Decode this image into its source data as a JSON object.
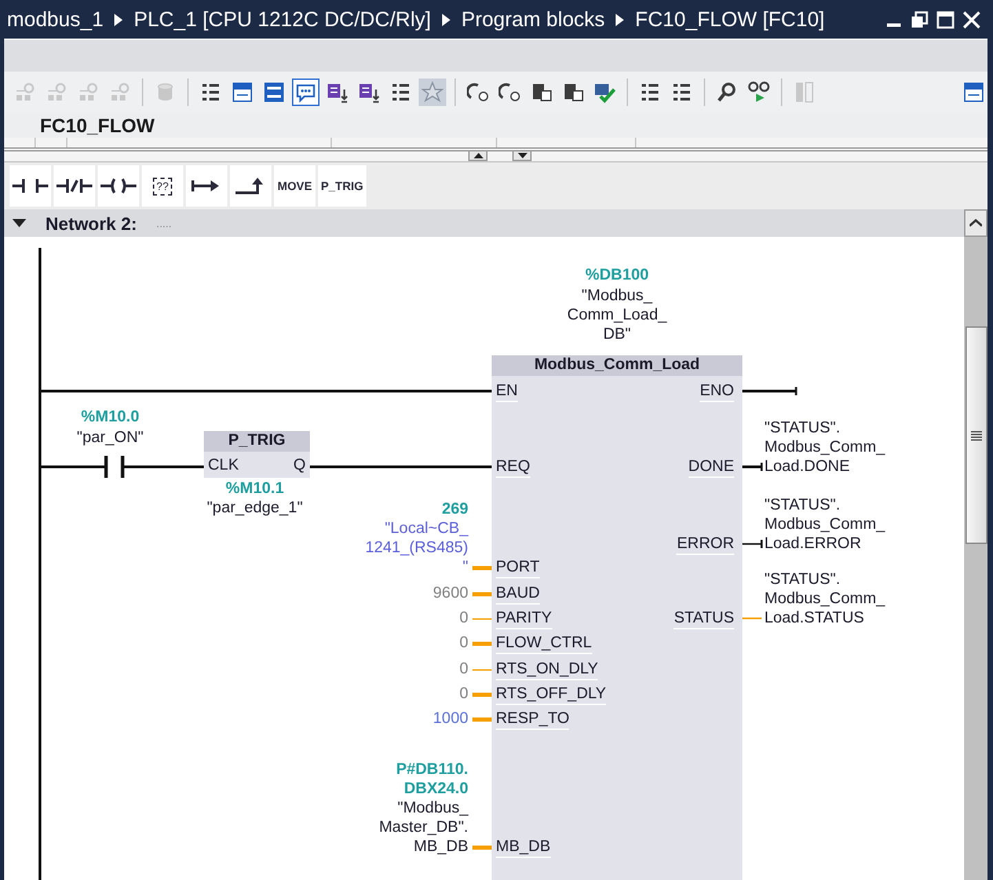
{
  "title_bar": {
    "breadcrumb": [
      "modbus_1",
      "PLC_1 [CPU 1212C DC/DC/Rly]",
      "Program blocks",
      "FC10_FLOW [FC10]"
    ]
  },
  "toolbar": [
    {
      "kind": "tool",
      "disabled": true,
      "selected": false,
      "on": false
    },
    {
      "kind": "tool",
      "disabled": true,
      "selected": false,
      "on": false
    },
    {
      "kind": "tool",
      "disabled": true,
      "selected": false,
      "on": false
    },
    {
      "kind": "tool",
      "disabled": true,
      "selected": false,
      "on": false
    },
    {
      "kind": "separator"
    },
    {
      "kind": "tool",
      "disabled": true,
      "selected": false,
      "on": false
    },
    {
      "kind": "separator"
    },
    {
      "kind": "tool",
      "disabled": false,
      "selected": false,
      "on": false
    },
    {
      "kind": "tool",
      "disabled": false,
      "selected": false,
      "on": false
    },
    {
      "kind": "tool",
      "disabled": false,
      "selected": false,
      "on": false
    },
    {
      "kind": "tool",
      "disabled": false,
      "selected": true,
      "on": false
    },
    {
      "kind": "tool",
      "disabled": false,
      "selected": false,
      "on": false
    },
    {
      "kind": "tool",
      "disabled": false,
      "selected": false,
      "on": false
    },
    {
      "kind": "tool",
      "disabled": false,
      "selected": false,
      "on": false
    },
    {
      "kind": "tool",
      "disabled": false,
      "selected": false,
      "on": true
    },
    {
      "kind": "separator"
    },
    {
      "kind": "tool",
      "disabled": false,
      "selected": false,
      "on": false
    },
    {
      "kind": "tool",
      "disabled": false,
      "selected": false,
      "on": false
    },
    {
      "kind": "tool",
      "disabled": false,
      "selected": false,
      "on": false
    },
    {
      "kind": "tool",
      "disabled": false,
      "selected": false,
      "on": false
    },
    {
      "kind": "tool",
      "disabled": false,
      "selected": false,
      "on": false
    },
    {
      "kind": "separator"
    },
    {
      "kind": "tool",
      "disabled": false,
      "selected": false,
      "on": false
    },
    {
      "kind": "tool",
      "disabled": false,
      "selected": false,
      "on": false
    },
    {
      "kind": "separator"
    },
    {
      "kind": "tool",
      "disabled": false,
      "selected": false,
      "on": false
    },
    {
      "kind": "tool",
      "disabled": false,
      "selected": false,
      "on": false
    },
    {
      "kind": "separator"
    },
    {
      "kind": "tool",
      "disabled": true,
      "selected": false,
      "on": false
    },
    {
      "kind": "spacer"
    },
    {
      "kind": "tool",
      "disabled": false,
      "selected": false,
      "on": false
    }
  ],
  "block_title": "FC10_FLOW",
  "palette": [
    {
      "kind": "contact"
    },
    {
      "kind": "negated"
    },
    {
      "kind": "coil"
    },
    {
      "kind": "box",
      "label": "??"
    },
    {
      "kind": "branch"
    },
    {
      "kind": "close"
    },
    {
      "kind": "text",
      "label": "MOVE"
    },
    {
      "kind": "text",
      "label": "P_TRIG"
    }
  ],
  "network": {
    "title": "Network 2:",
    "comment": ".....",
    "expanded": true,
    "contact": {
      "address": "%M10.0",
      "tag": "\"par_ON\""
    },
    "edge": {
      "name": "P_TRIG",
      "input": "CLK",
      "output": "Q",
      "address": "%M10.1",
      "tag": "\"par_edge_1\""
    },
    "block": {
      "instance_address": "%DB100",
      "instance_tag": "\"Modbus_\nComm_Load_\nDB\"",
      "name": "Modbus_Comm_Load",
      "inputs": [
        {
          "pin": "EN",
          "kind": "rail"
        },
        {
          "pin": "REQ",
          "kind": "edge"
        },
        {
          "pin": "PORT",
          "kind": "parameter",
          "wide": true,
          "address": "269",
          "operand": "\"Local~CB_\n1241_(RS485)\n\"",
          "color": "#5b5fd9"
        },
        {
          "pin": "BAUD",
          "kind": "parameter",
          "wide": true,
          "operand": "9600",
          "color": "#808080"
        },
        {
          "pin": "PARITY",
          "kind": "parameter",
          "wide": false,
          "operand": "0",
          "color": "#808080"
        },
        {
          "pin": "FLOW_CTRL",
          "kind": "parameter",
          "wide": true,
          "operand": "0",
          "color": "#808080"
        },
        {
          "pin": "RTS_ON_DLY",
          "kind": "parameter",
          "wide": false,
          "operand": "0",
          "color": "#808080"
        },
        {
          "pin": "RTS_OFF_DLY",
          "kind": "parameter",
          "wide": true,
          "operand": "0",
          "color": "#808080"
        },
        {
          "pin": "RESP_TO",
          "kind": "parameter",
          "wide": true,
          "operand": "1000",
          "color": "#5b6fd9"
        },
        {
          "pin": "MB_DB",
          "kind": "parameter",
          "wide": true,
          "address": "P#DB110.\nDBX24.0",
          "operand": "\"Modbus_\nMaster_DB\".\nMB_DB",
          "color": "#1a1a2a"
        }
      ],
      "outputs": [
        {
          "pin": "ENO",
          "kind": "bool"
        },
        {
          "pin": "DONE",
          "kind": "bool",
          "operand": "\"STATUS\".\nModbus_Comm_\nLoad.DONE"
        },
        {
          "pin": "ERROR",
          "kind": "bool",
          "operand": "\"STATUS\".\nModbus_Comm_\nLoad.ERROR"
        },
        {
          "pin": "STATUS",
          "kind": "data",
          "operand": "\"STATUS\".\nModbus_Comm_\nLoad.STATUS"
        }
      ]
    }
  }
}
